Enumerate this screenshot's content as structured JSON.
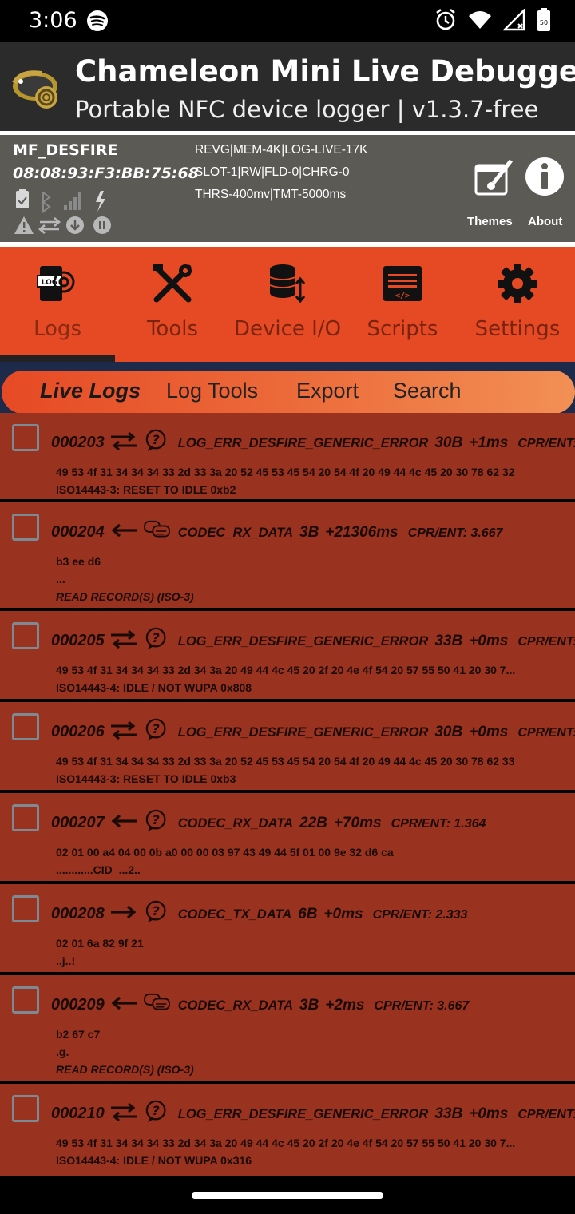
{
  "status_bar": {
    "time": "3:06",
    "icons": [
      "spotify-icon",
      "alarm-icon",
      "wifi-icon",
      "signal-icon",
      "battery-icon"
    ],
    "battery_level": "50"
  },
  "app": {
    "title": "Chameleon Mini Live Debugger",
    "subtitle": "Portable NFC device logger | v1.3.7-free"
  },
  "device": {
    "name": "MF_DESFIRE",
    "uid": "08:08:93:F3:BB:75:68",
    "config_lines": [
      "REVG|MEM-4K|LOG-LIVE-17K",
      "SLOT-1|RW|FLD-0|CHRG-0",
      "THRS-400mv|TMT-5000ms"
    ],
    "themes_label": "Themes",
    "about_label": "About"
  },
  "nav_tabs": [
    {
      "label": "Logs",
      "icon": "log-file-icon",
      "active": true
    },
    {
      "label": "Tools",
      "icon": "tools-icon",
      "active": false
    },
    {
      "label": "Device I/O",
      "icon": "database-transfer-icon",
      "active": false
    },
    {
      "label": "Scripts",
      "icon": "script-window-icon",
      "active": false
    },
    {
      "label": "Settings",
      "icon": "gear-icon",
      "active": false
    }
  ],
  "sub_tabs": [
    {
      "label": "Live Logs",
      "active": true
    },
    {
      "label": "Log Tools",
      "active": false
    },
    {
      "label": "Export",
      "active": false
    },
    {
      "label": "Search",
      "active": false
    }
  ],
  "logs": [
    {
      "num": "000203",
      "dir": "bidirectional",
      "kind": "question",
      "cmd": "LOG_ERR_DESFIRE_GENERIC_ERROR",
      "bytes": "30B",
      "delta": "+1ms",
      "ent": "CPR/ENT:...",
      "data": "49 53 4f 31 34 34 34 33 2d 33 3a 20 52 45 53 45 54 20 54 4f 20 49 44 4c 45 20 30 78 62 32",
      "ascii": "",
      "note": "ISO14443-3: RESET TO IDLE 0xb2",
      "note_style": "bold"
    },
    {
      "num": "000204",
      "dir": "left",
      "kind": "speech",
      "cmd": "CODEC_RX_DATA",
      "bytes": "3B",
      "delta": "+21306ms",
      "ent": "CPR/ENT: 3.667",
      "data": "b3 ee d6",
      "ascii": "...",
      "note": "READ RECORD(S) (ISO-3)",
      "note_style": "italic"
    },
    {
      "num": "000205",
      "dir": "bidirectional",
      "kind": "question",
      "cmd": "LOG_ERR_DESFIRE_GENERIC_ERROR",
      "bytes": "33B",
      "delta": "+0ms",
      "ent": "CPR/ENT:...",
      "data": "49 53 4f 31 34 34 34 33 2d 34 3a 20 49 44 4c 45 20 2f 20 4e 4f 54 20 57 55 50 41 20 30 7...",
      "ascii": "",
      "note": "ISO14443-4: IDLE / NOT WUPA 0x808",
      "note_style": "bold"
    },
    {
      "num": "000206",
      "dir": "bidirectional",
      "kind": "question",
      "cmd": "LOG_ERR_DESFIRE_GENERIC_ERROR",
      "bytes": "30B",
      "delta": "+0ms",
      "ent": "CPR/ENT:...",
      "data": "49 53 4f 31 34 34 34 33 2d 33 3a 20 52 45 53 45 54 20 54 4f 20 49 44 4c 45 20 30 78 62 33",
      "ascii": "",
      "note": "ISO14443-3: RESET TO IDLE 0xb3",
      "note_style": "bold"
    },
    {
      "num": "000207",
      "dir": "left",
      "kind": "question",
      "cmd": "CODEC_RX_DATA",
      "bytes": "22B",
      "delta": "+70ms",
      "ent": "CPR/ENT: 1.364",
      "data": "02 01 00 a4 04 00 0b a0 00 00 03 97 43 49 44 5f 01 00 9e 32 d6 ca",
      "ascii": "............CID_...2..",
      "note": "",
      "note_style": "bold"
    },
    {
      "num": "000208",
      "dir": "right",
      "kind": "question",
      "cmd": "CODEC_TX_DATA",
      "bytes": "6B",
      "delta": "+0ms",
      "ent": "CPR/ENT: 2.333",
      "data": "02 01 6a 82 9f 21",
      "ascii": "..j..!",
      "note": "",
      "note_style": "bold"
    },
    {
      "num": "000209",
      "dir": "left",
      "kind": "speech",
      "cmd": "CODEC_RX_DATA",
      "bytes": "3B",
      "delta": "+2ms",
      "ent": "CPR/ENT: 3.667",
      "data": "b2 67 c7",
      "ascii": ".g.",
      "note": "READ RECORD(S) (ISO-3)",
      "note_style": "italic"
    },
    {
      "num": "000210",
      "dir": "bidirectional",
      "kind": "question",
      "cmd": "LOG_ERR_DESFIRE_GENERIC_ERROR",
      "bytes": "33B",
      "delta": "+0ms",
      "ent": "CPR/ENT:...",
      "data": "49 53 4f 31 34 34 34 33 2d 34 3a 20 49 44 4c 45 20 2f 20 4e 4f 54 20 57 55 50 41 20 30 7...",
      "ascii": "",
      "note": "ISO14443-4: IDLE / NOT WUPA 0x316",
      "note_style": "bold"
    }
  ]
}
